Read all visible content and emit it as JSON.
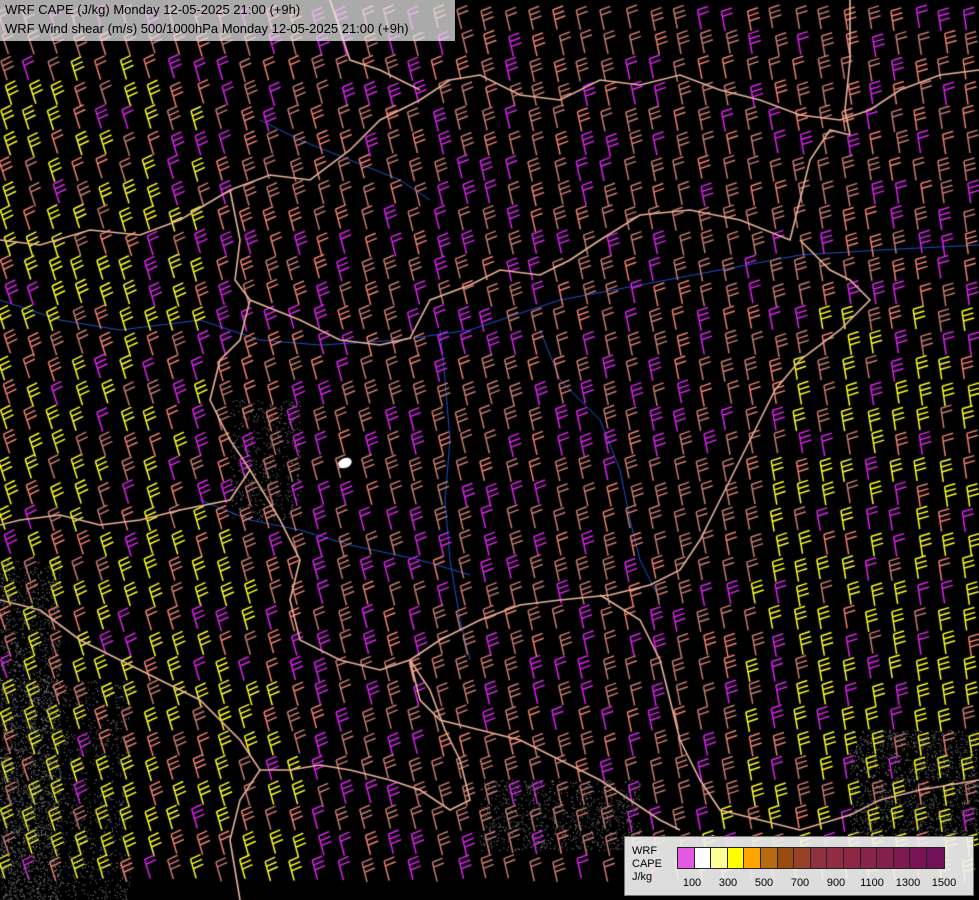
{
  "header": {
    "line1": "WRF CAPE (J/kg) Monday 12-05-2025 21:00 (+9h)",
    "line2": "WRF Wind shear (m/s) 500/1000hPa Monday 12-05-2025 21:00 (+9h)"
  },
  "legend": {
    "title_line1": "WRF",
    "title_line2": "CAPE",
    "title_line3": "J/kg",
    "colors": [
      "#e15ae1",
      "#ffffff",
      "#ffff9a",
      "#ffff00",
      "#ffa500",
      "#b86a12",
      "#9a4c10",
      "#96402a",
      "#8e3040",
      "#902c44",
      "#8c2844",
      "#882448",
      "#84204c",
      "#7e1a50",
      "#781454",
      "#721058"
    ],
    "tick_labels": [
      "100",
      "300",
      "500",
      "700",
      "900",
      "1100",
      "1300",
      "1500"
    ]
  },
  "map": {
    "barb_palette": {
      "magenta": "#dd22ee",
      "salmon": "#f08070",
      "rose": "#c87a70",
      "yellow": "#ffff22",
      "border": "#e8b49a",
      "river": "#1e50c8"
    },
    "wind_direction": "north-northeast"
  }
}
